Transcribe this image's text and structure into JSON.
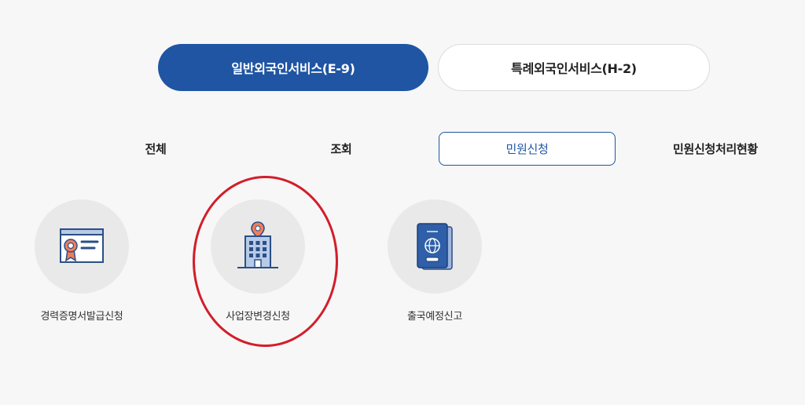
{
  "service_toggle": {
    "general_label": "일반외국인서비스(E-9)",
    "special_label": "특례외국인서비스(H-2)"
  },
  "tabs": {
    "all": "전체",
    "inquiry": "조회",
    "apply": "민원신청",
    "status": "민원신청처리현황"
  },
  "services": [
    {
      "label": "경력증명서발급신청",
      "icon": "certificate-icon"
    },
    {
      "label": "사업장변경신청",
      "icon": "building-icon"
    },
    {
      "label": "출국예정신고",
      "icon": "passport-icon"
    }
  ],
  "colors": {
    "primary": "#1f55a3",
    "background": "#f7f7f7",
    "icon_circle": "#e9e9e9",
    "annotation": "#d21e2a"
  }
}
